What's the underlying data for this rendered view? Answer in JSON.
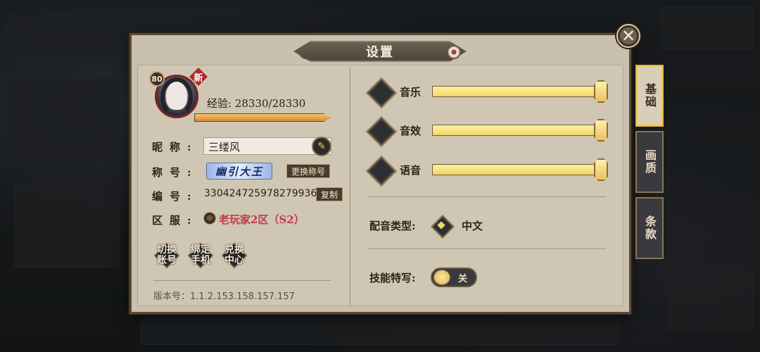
{
  "dialog": {
    "title": "设置"
  },
  "tabs": [
    {
      "label": "基础",
      "active": true
    },
    {
      "label": "画质",
      "active": false
    },
    {
      "label": "条款",
      "active": false
    }
  ],
  "profile": {
    "level": "80",
    "new_badge": "新",
    "exp_label": "经验:",
    "exp_value": "28330/28330",
    "exp_progress": 1.0,
    "nickname_label": "昵称:",
    "nickname": "三缕风",
    "title_label": "称号:",
    "title_value": "幽引大王",
    "change_title_button": "更换称号",
    "id_label": "编号:",
    "id_value": "3304247259782799360",
    "copy_button": "复制",
    "server_label": "区服:",
    "server_value": "老玩家2区（S2）"
  },
  "actions": [
    {
      "label": "切换\n账号"
    },
    {
      "label": "绑定\n手机"
    },
    {
      "label": "兑换\n中心"
    }
  ],
  "version": {
    "label": "版本号：",
    "value": "1.1.2.153.158.157.157"
  },
  "audio": [
    {
      "label": "音乐",
      "level": 1.0
    },
    {
      "label": "音效",
      "level": 1.0
    },
    {
      "label": "语音",
      "level": 1.0
    }
  ],
  "voice_type": {
    "label": "配音类型:",
    "value": "中文"
  },
  "skill_closeup": {
    "label": "技能特写:",
    "toggle_label": "关",
    "enabled": false
  },
  "colors": {
    "accent": "#f2d666",
    "server_text": "#c2384a",
    "panel": "#cfc7b3"
  }
}
